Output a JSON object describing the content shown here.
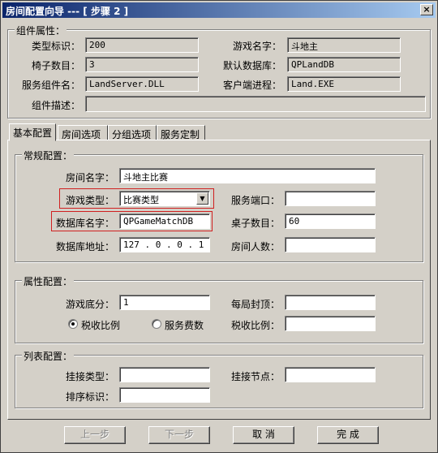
{
  "window": {
    "title": "房间配置向导 --- [ 步骤 2 ]",
    "close": "×"
  },
  "component": {
    "legend": "组件属性：",
    "type_label": "类型标识：",
    "type_value": "200",
    "game_name_label": "游戏名字：",
    "game_name_value": "斗地主",
    "chair_label": "椅子数目：",
    "chair_value": "3",
    "db_label": "默认数据库：",
    "db_value": "QPLandDB",
    "service_label": "服务组件名：",
    "service_value": "LandServer.DLL",
    "client_label": "客户端进程：",
    "client_value": "Land.EXE",
    "desc_label": "组件描述：",
    "desc_value": ""
  },
  "tabs": [
    "基本配置",
    "房间选项",
    "分组选项",
    "服务定制"
  ],
  "general": {
    "legend": "常规配置：",
    "room_name_label": "房间名字：",
    "room_name_value": "斗地主比赛",
    "game_type_label": "游戏类型：",
    "game_type_value": "比赛类型",
    "service_port_label": "服务端口：",
    "service_port_value": "",
    "db_name_label": "数据库名字：",
    "db_name_value": "QPGameMatchDB",
    "table_count_label": "桌子数目：",
    "table_count_value": "60",
    "db_addr_label": "数据库地址：",
    "db_addr_value": "127 . 0  . 0  . 1",
    "room_people_label": "房间人数：",
    "room_people_value": ""
  },
  "attributes": {
    "legend": "属性配置：",
    "base_score_label": "游戏底分：",
    "base_score_value": "1",
    "max_label": "每局封顶：",
    "max_value": "",
    "radio_tax": "税收比例",
    "radio_fee": "服务费数",
    "tax_label": "税收比例：",
    "tax_value": ""
  },
  "list": {
    "legend": "列表配置：",
    "mount_type_label": "挂接类型：",
    "mount_type_value": "",
    "mount_node_label": "挂接节点：",
    "mount_node_value": "",
    "sort_label": "排序标识：",
    "sort_value": ""
  },
  "buttons": {
    "prev": "上一步",
    "next": "下一步",
    "cancel": "取 消",
    "finish": "完 成"
  },
  "colors": {
    "title_start": "#0a246a",
    "highlight_box": "#d02020"
  }
}
